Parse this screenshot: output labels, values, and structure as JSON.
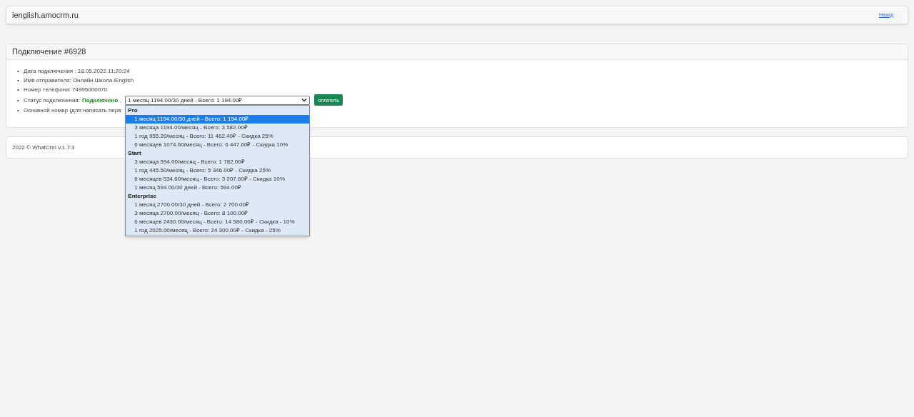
{
  "header": {
    "title": "ienglish.amocrm.ru",
    "back_link": "Назад"
  },
  "connection": {
    "title": "Подключение #6928",
    "details": [
      {
        "kind": "plain",
        "bullet": "•",
        "text": "Дата подключения : 18.05.2022 11:20:24"
      },
      {
        "kind": "plain",
        "bullet": "•",
        "text": "Имя отправителя: Онлайн Школа iEnglish"
      },
      {
        "kind": "plain",
        "bullet": "•",
        "text": "Номер телефона: 74995000070"
      },
      {
        "kind": "status",
        "bullet": "•",
        "label": "Статус подключения:",
        "status": "Подключено",
        "separator": ","
      },
      {
        "kind": "plain",
        "bullet": "•",
        "text": "Основной номер (для написать перв"
      }
    ],
    "plan_select": {
      "value": "1 месяц 1194.00/30 дней - Всего: 1 194.00₽",
      "expanded": true,
      "groups": [
        {
          "label": "Pro",
          "options": [
            {
              "label": "1 месяц 1194.00/30 дней - Всего: 1 194.00₽",
              "selected": true
            },
            {
              "label": "3 месяца 1194.00/месяц - Всего: 3 582.00₽",
              "selected": false
            },
            {
              "label": "1 год 955.20/месяц - Всего: 11 462.40₽ - Скидка 25%",
              "selected": false
            },
            {
              "label": "6 месяцев 1074.60/месяц - Всего: 6 447.60₽ - Скидка 10%",
              "selected": false
            }
          ]
        },
        {
          "label": "Start",
          "options": [
            {
              "label": "3 месяца 594.00/месяц - Всего: 1 782.00₽",
              "selected": false
            },
            {
              "label": "1 год 445.50/месяц - Всего: 5 346.00₽ - Скидка 25%",
              "selected": false
            },
            {
              "label": "6 месяцев 534.60/месяц - Всего: 3 207.60₽ - Скидка 10%",
              "selected": false
            },
            {
              "label": "1 месяц 594.00/30 дней - Всего: 594.00₽",
              "selected": false
            }
          ]
        },
        {
          "label": "Enterprise",
          "options": [
            {
              "label": "1 месяц 2700.00/30 дней - Всего: 2 700.00₽",
              "selected": false
            },
            {
              "label": "3 месяца 2700.00/месяц - Всего: 8 100.00₽",
              "selected": false
            },
            {
              "label": "6 месяцев 2430.00/месяц - Всего: 14 580.00₽ - Скидка - 10%",
              "selected": false
            },
            {
              "label": "1 год 2025.00/месяц - Всего: 24 300.00₽ - Скидка - 25%",
              "selected": false
            }
          ]
        }
      ]
    },
    "pay_button": "оплатить"
  },
  "footer": {
    "text": "2022 © WhatCrm v.1.7.3"
  }
}
